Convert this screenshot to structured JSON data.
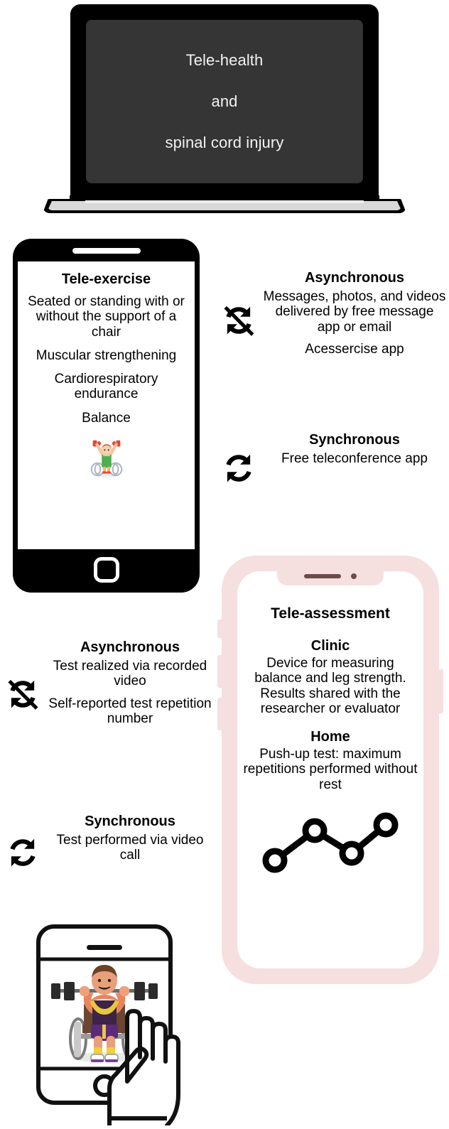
{
  "figure": {
    "title": "Tele-health and spinal cord injury infographic"
  },
  "laptop": {
    "screen": {
      "line1": "Tele-health",
      "line2": "and",
      "line3": "spinal cord injury",
      "bg_color": "#353535",
      "text_color": "#f2f2f2"
    },
    "bezel_color": "#000000",
    "base_color": "#d9d9d9"
  },
  "tele_exercise": {
    "device": "black-smartphone",
    "title": "Tele-exercise",
    "lines": [
      "Seated or standing with or without the support of a chair",
      "Muscular strengthening",
      "Cardiorespiratory endurance",
      "Balance"
    ],
    "illustration_name": "wheelchair-weightlifter-emoji",
    "frame_color": "#000000",
    "screen_color": "#ffffff"
  },
  "exercise_modes": [
    {
      "id": "exercise-async",
      "icon": "async-slashed-sync-icon",
      "heading": "Asynchronous",
      "paragraphs": [
        "Messages, photos, and videos delivered by free message app or email",
        "Acessercise app"
      ]
    },
    {
      "id": "exercise-sync",
      "icon": "sync-icon",
      "heading": "Synchronous",
      "paragraphs": [
        "Free teleconference app"
      ]
    }
  ],
  "assessment_modes": [
    {
      "id": "assessment-async",
      "icon": "async-slashed-sync-icon",
      "heading": "Asynchronous",
      "paragraphs": [
        "Test realized via recorded video",
        "Self-reported test repetition number"
      ]
    },
    {
      "id": "assessment-sync",
      "icon": "sync-icon",
      "heading": "Synchronous",
      "paragraphs": [
        "Test performed via video call"
      ]
    }
  ],
  "tele_assessment": {
    "device": "pink-smartphone",
    "title": "Tele-assessment",
    "sections": [
      {
        "heading": "Clinic",
        "body": "Device for measuring balance and leg strength. Results shared with the researcher or evaluator"
      },
      {
        "heading": "Home",
        "body": "Push-up test: maximum repetitions performed without rest"
      }
    ],
    "chart_icon_name": "line-chart-icon",
    "frame_color": "#f6dfdf",
    "accent_color": "#6e4a4a",
    "screen_color": "#ffffff"
  },
  "tablet_illustration": {
    "name": "tablet-with-wheelchair-athlete-and-touch-hand",
    "device": "tablet",
    "content_name": "wheelchair-athlete-barbell-illustration",
    "pointer_name": "touch-hand-icon",
    "outline_color": "#111111"
  },
  "chart_data": {
    "type": "line",
    "title": "",
    "x": [
      1,
      2,
      3,
      4
    ],
    "values": [
      1,
      3,
      1.6,
      3.6
    ],
    "xlabel": "",
    "ylabel": "",
    "grid": false,
    "marker": "open-circle",
    "legend": "none",
    "note": "Decorative line-chart glyph inside the Tele-assessment phone showing four plotted points."
  }
}
